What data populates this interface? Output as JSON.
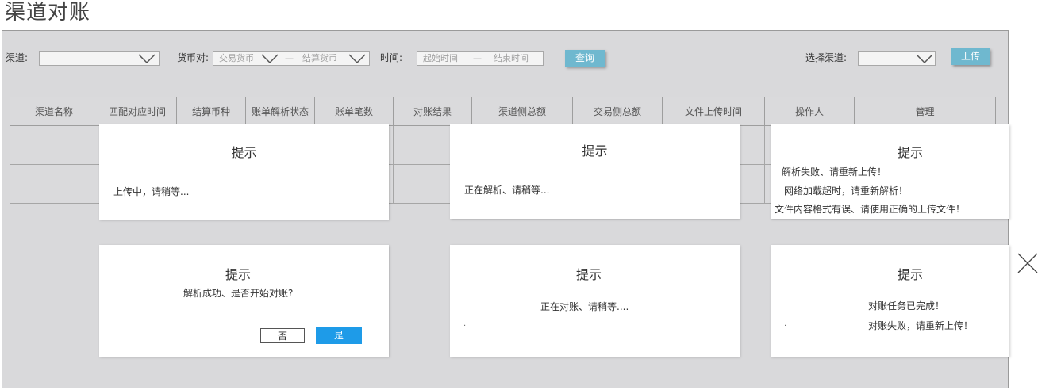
{
  "page": {
    "title": "渠道对账"
  },
  "filters": {
    "channel_label": "渠道:",
    "channel_value": "",
    "currency_pair_label": "货币对:",
    "trade_currency_placeholder": "交易货币",
    "settle_currency_placeholder": "结算货币",
    "dash": "—",
    "time_label": "时间:",
    "start_time_placeholder": "起始时间",
    "end_time_placeholder": "结束时间",
    "query_button": "查询",
    "select_channel_label": "选择渠道:",
    "select_channel_value": "",
    "upload_button": "上传"
  },
  "table": {
    "columns": [
      "渠道名称",
      "匹配对应时间",
      "结算币种",
      "账单解析状态",
      "账单笔数",
      "对账结果",
      "渠道侧总额",
      "交易侧总额",
      "文件上传时间",
      "操作人",
      "管理"
    ],
    "rows": [
      [],
      []
    ]
  },
  "dialogs": {
    "uploading": {
      "title": "提示",
      "message": "上传中，请稍等..."
    },
    "parsing": {
      "title": "提示",
      "message": "正在解析、请稍等..."
    },
    "parse_errors": {
      "title": "提示",
      "messages": [
        "解析失败、请重新上传！",
        "网络加载超时，请重新解析！",
        "文件内容格式有误、请使用正确的上传文件！"
      ]
    },
    "parse_success": {
      "title": "提示",
      "message": "解析成功、是否开始对账?",
      "no_label": "否",
      "yes_label": "是"
    },
    "reconciling": {
      "title": "提示",
      "message": "正在对账、请稍等....",
      "dot": "."
    },
    "reconcile_result": {
      "title": "提示",
      "messages": [
        "对账任务已完成！",
        "对账失败，请重新上传！"
      ],
      "dot": "."
    }
  },
  "colors": {
    "accent_button": "#6fb8cf",
    "yes_button": "#1e9be8",
    "panel_bg": "#d9d9db"
  },
  "icons": {
    "dropdown": "chevron-down-icon",
    "close": "close-icon"
  }
}
